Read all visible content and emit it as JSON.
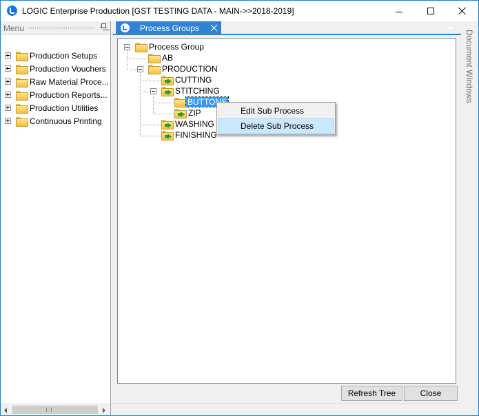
{
  "window": {
    "title": "LOGIC Enterprise Production  [GST TESTING DATA - MAIN->>2018-2019]",
    "minimize_glyph": "",
    "maximize_glyph": "",
    "close_glyph": ""
  },
  "menu_panel": {
    "header": "Menu",
    "items": [
      {
        "label": "Production Setups"
      },
      {
        "label": "Production Vouchers"
      },
      {
        "label": "Raw Material Proce..."
      },
      {
        "label": "Production  Reports..."
      },
      {
        "label": "Production Utilities"
      },
      {
        "label": "Continuous Printing"
      }
    ]
  },
  "tab": {
    "label": "Process Groups"
  },
  "tree": {
    "root": "Process Group",
    "ab": "AB",
    "production": "PRODUCTION",
    "cutting": "CUTTING",
    "stitching": "STITCHING",
    "buttons": "BUTTONS",
    "zip": "ZIP",
    "washing": "WASHING",
    "finishing": "FINISHING",
    "selected": "BUTTONS"
  },
  "buttons": {
    "refresh": "Refresh Tree",
    "close": "Close"
  },
  "side_panel": {
    "label": "Document Windows"
  },
  "context_menu": {
    "items": [
      {
        "label": "Edit Sub Process"
      },
      {
        "label": "Delete Sub Process"
      }
    ],
    "highlighted": "Delete Sub Process"
  },
  "colors": {
    "accent": "#2f82d6",
    "selection": "#3399ff",
    "menu_highlight": "#cce8ff"
  }
}
